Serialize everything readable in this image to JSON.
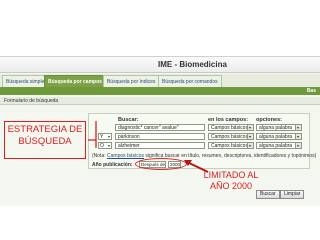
{
  "app": {
    "title": "IME - Biomedicina"
  },
  "tabs": [
    {
      "label": "Búsqueda simple"
    },
    {
      "label": "Búsqueda por campos",
      "active": true
    },
    {
      "label": "Búsqueda por índices"
    },
    {
      "label": "Búsqueda por comandos"
    }
  ],
  "greenbar": {
    "right_text": "Bas"
  },
  "form": {
    "header": "Formulario de búsqueda",
    "col_buscar": "Buscar:",
    "col_campos": "en los campos:",
    "col_opciones": "opciones:",
    "rows": [
      {
        "operator": "",
        "query": "diagnostic* cancer\" avalue\"",
        "field": "Campos básicos",
        "option": "alguna palabra"
      },
      {
        "operator": "Y",
        "query": "parkinson",
        "field": "Campos básicos",
        "option": "alguna palabra"
      },
      {
        "operator": "O",
        "query": "alzheimer",
        "field": "Campos básicos",
        "option": "alguna palabra"
      }
    ],
    "note_prefix": "(Nota: ",
    "note_link": "Campos básicos",
    "note_suffix": " significa buscar en título, resumen, descriptores, identificadores y topónimos)",
    "year_label": "Año publicación:",
    "year_mode": "Después de",
    "year_value": "2000",
    "search_button": "Buscar",
    "clear_button": "Limpiar"
  },
  "annotations": {
    "strategy_line1": "ESTRATEGIA DE",
    "strategy_line2": "BÚSQUEDA",
    "limit_line1": "LIMITADO AL",
    "limit_line2": "AÑO 2000"
  },
  "colors": {
    "accent_green": "#6f9a3b",
    "annotation_red": "#d92020"
  }
}
